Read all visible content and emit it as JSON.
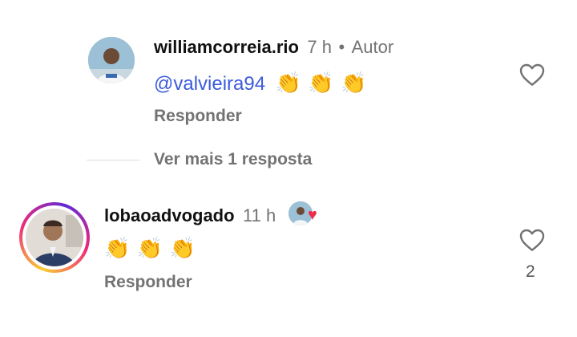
{
  "reply": {
    "username": "williamcorreia.rio",
    "time": "7 h",
    "separator": "•",
    "author_badge": "Autor",
    "mention": "@valvieira94",
    "emojis": [
      "👏",
      "👏",
      "👏"
    ],
    "reply_label": "Responder"
  },
  "view_more": {
    "label": "Ver mais 1 resposta"
  },
  "comment": {
    "username": "lobaoadvogado",
    "time": "11 h",
    "emojis": [
      "👏",
      "👏",
      "👏"
    ],
    "reply_label": "Responder",
    "like_count": "2"
  },
  "colors": {
    "mention": "#3b5bdb",
    "muted": "#737373",
    "heart": "#ed2c4a"
  }
}
